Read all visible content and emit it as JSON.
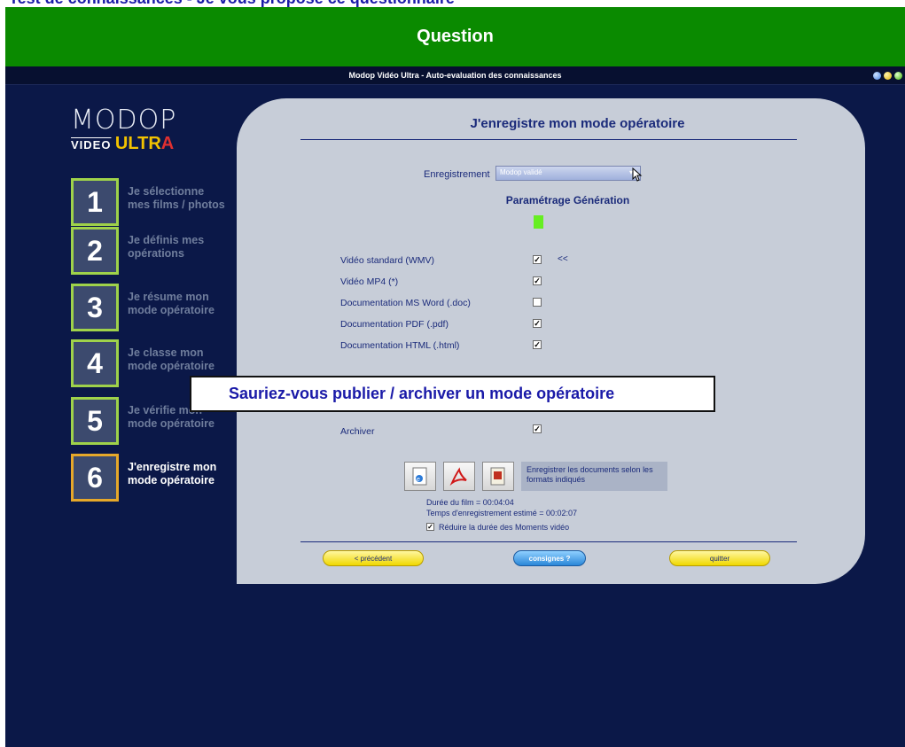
{
  "top_strip_text": "Test de connaissances - Je vous propose ce questionnaire",
  "question_banner": "Question",
  "window_title": "Modop Vidéo Ultra - Auto-evaluation des connaissances",
  "logo": {
    "main": "MODOP",
    "sub_video": "VIDEO",
    "sub_ultr": "ULTR",
    "sub_a": "A"
  },
  "steps": [
    {
      "num": "1",
      "label": "Je sélectionne\nmes films / photos"
    },
    {
      "num": "2",
      "label": "Je définis mes\nopérations"
    },
    {
      "num": "3",
      "label": "Je résume mon\nmode opératoire"
    },
    {
      "num": "4",
      "label": "Je classe mon\nmode opératoire"
    },
    {
      "num": "5",
      "label": "Je vérifie mon\nmode opératoire"
    },
    {
      "num": "6",
      "label": "J'enregistre mon\nmode opératoire"
    }
  ],
  "panel": {
    "title": "J'enregistre mon mode opératoire",
    "enregistrement_label": "Enregistrement",
    "enregistrement_value": "Modop validé",
    "sub_title": "Paramétrage Génération",
    "options": [
      {
        "label": "Vidéo standard (WMV)",
        "checked": "✓",
        "note": "<<"
      },
      {
        "label": "Vidéo MP4 (*)",
        "checked": "✓"
      },
      {
        "label": "Documentation MS Word (.doc)",
        "checked": ""
      },
      {
        "label": "Documentation PDF (.pdf)",
        "checked": "✓"
      },
      {
        "label": "Documentation HTML (.html)",
        "checked": "✓"
      }
    ],
    "archiver_label": "Archiver",
    "archiver_checked": "✓",
    "export_info": "Enregistrer les documents selon les formats indiqués",
    "duree_film": "Durée du film = 00:04:04",
    "temps_estime": "Temps d'enregistrement estimé = 00:02:07",
    "reduire_label": "Réduire la durée des Moments vidéo",
    "reduire_checked": "✓",
    "btn_prev": "< précédent",
    "btn_consignes": "consignes ?",
    "btn_quit": "quitter"
  },
  "overlay_question": "Sauriez-vous publier / archiver un mode opératoire"
}
